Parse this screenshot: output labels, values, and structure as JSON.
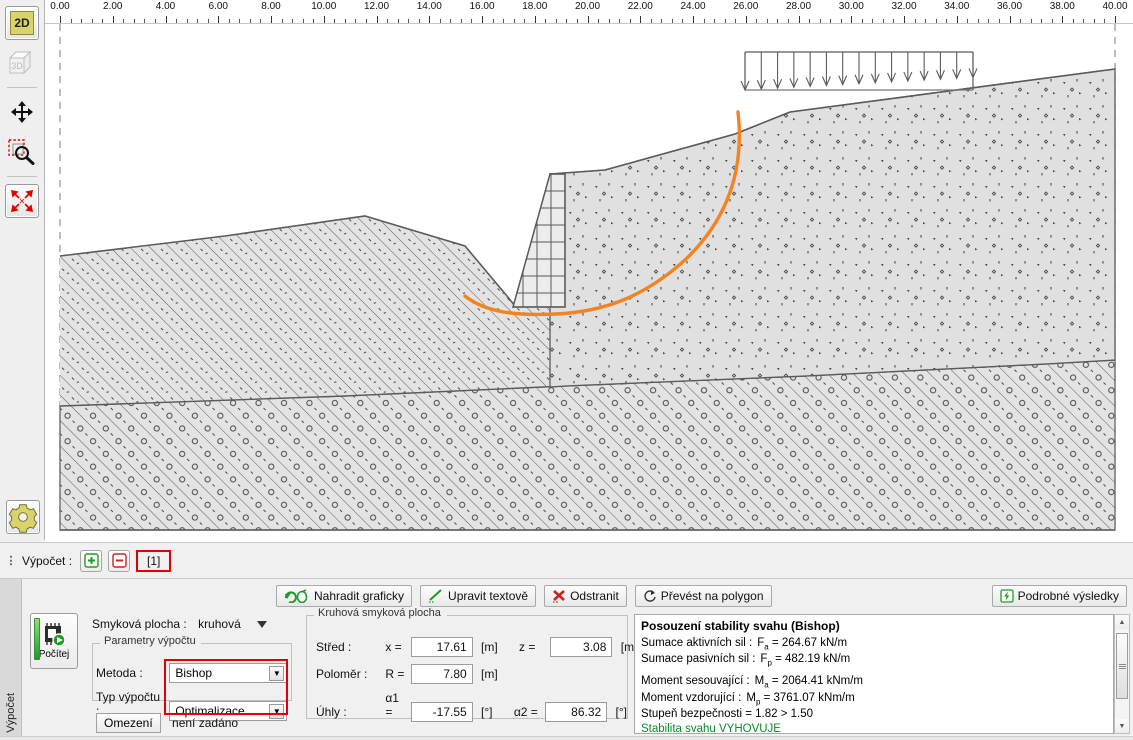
{
  "left_toolbar": {
    "items": [
      {
        "name": "view-2d",
        "label": "2D",
        "icon": "2d-icon",
        "active": true
      },
      {
        "name": "view-3d",
        "label": "3D",
        "icon": "3d-icon",
        "active": false
      },
      {
        "name": "pan",
        "label": "",
        "icon": "move-arrows-icon"
      },
      {
        "name": "zoom-window",
        "label": "",
        "icon": "zoom-window-icon"
      },
      {
        "name": "fit-screen",
        "label": "",
        "icon": "fit-screen-icon"
      },
      {
        "name": "settings",
        "label": "",
        "icon": "gear-icon"
      }
    ]
  },
  "ruler": {
    "min": 0.0,
    "max": 40.0,
    "step": 2.0,
    "minor_per_major": 5,
    "labels": [
      "0.00",
      "2.00",
      "4.00",
      "6.00",
      "8.00",
      "10.00",
      "12.00",
      "14.00",
      "16.00",
      "18.00",
      "20.00",
      "22.00",
      "24.00",
      "26.00",
      "28.00",
      "30.00",
      "32.00",
      "34.00",
      "36.00",
      "38.00",
      "40.00"
    ]
  },
  "calc_tabbar": {
    "label": "Výpočet :",
    "add_button": "+",
    "remove_button": "−",
    "active_tab": "[1]",
    "highlight_color": "#e30000"
  },
  "toolbar": {
    "replace_graphically": "Nahradit graficky",
    "edit_textually": "Upravit textově",
    "remove": "Odstranit",
    "convert_to_polygon": "Převést na polygon",
    "detailed_results": "Podrobné výsledky"
  },
  "run": {
    "label": "Počítej",
    "icon": "calculate-chip-icon"
  },
  "side_tab": {
    "label": "Výpočet"
  },
  "slip_surface": {
    "label": "Smyková plocha :",
    "value": "kruhová"
  },
  "calc_params": {
    "group_title": "Parametry výpočtu",
    "method_label": "Metoda :",
    "method_value": "Bishop",
    "calc_type_label": "Typ výpočtu :",
    "calc_type_value": "Optimalizace",
    "restriction_button": "Omezení",
    "restriction_value": "není zadáno",
    "highlight_color": "#e30000"
  },
  "circular_surface": {
    "group_title": "Kruhová smyková plocha",
    "center_label": "Střed :",
    "center_x_label": "x =",
    "center_x": "17.61",
    "center_x_unit": "[m]",
    "center_z_label": "z =",
    "center_z": "3.08",
    "center_z_unit": "[m]",
    "radius_label": "Poloměr :",
    "radius_symbol": "R =",
    "radius": "7.80",
    "radius_unit": "[m]",
    "angles_label": "Úhly :",
    "alpha1_label": "α1 =",
    "alpha1": "-17.55",
    "alpha1_unit": "[°]",
    "alpha2_label": "α2 =",
    "alpha2": "86.32",
    "alpha2_unit": "[°]"
  },
  "results": {
    "title": "Posouzení stability svahu (Bishop)",
    "lines": [
      {
        "label": "Sumace aktivních sil :",
        "symbol": "Fa",
        "sym_base": "F",
        "sym_sub": "a",
        "eq": "=",
        "value": "264.67",
        "unit": "kN/m"
      },
      {
        "label": "Sumace pasivních sil :",
        "symbol": "Fp",
        "sym_base": "F",
        "sym_sub": "p",
        "eq": "=",
        "value": "482.19",
        "unit": "kN/m"
      },
      {
        "label": "Moment sesouvající :",
        "symbol": "Ma",
        "sym_base": "M",
        "sym_sub": "a",
        "eq": "=",
        "value": "2064.41",
        "unit": "kNm/m"
      },
      {
        "label": "Moment vzdorující :",
        "symbol": "Mp",
        "sym_base": "M",
        "sym_sub": "p",
        "eq": "=",
        "value": "3761.07",
        "unit": "kNm/m"
      }
    ],
    "safety_factor_text": "Stupeň bezpečnosti = 1.82 > 1.50",
    "verdict": "Stabilita svahu VYHOVUJE",
    "verdict_color": "#0a8a28"
  },
  "drawing": {
    "slip_surface_color": "#f58220",
    "soil_fill": "#e3e3e3",
    "line_color": "#5a5a5a",
    "load_arrow_count": 15,
    "description": "Slope stability cross-section with reinforced block wall, two soil layers and circular slip surface"
  }
}
